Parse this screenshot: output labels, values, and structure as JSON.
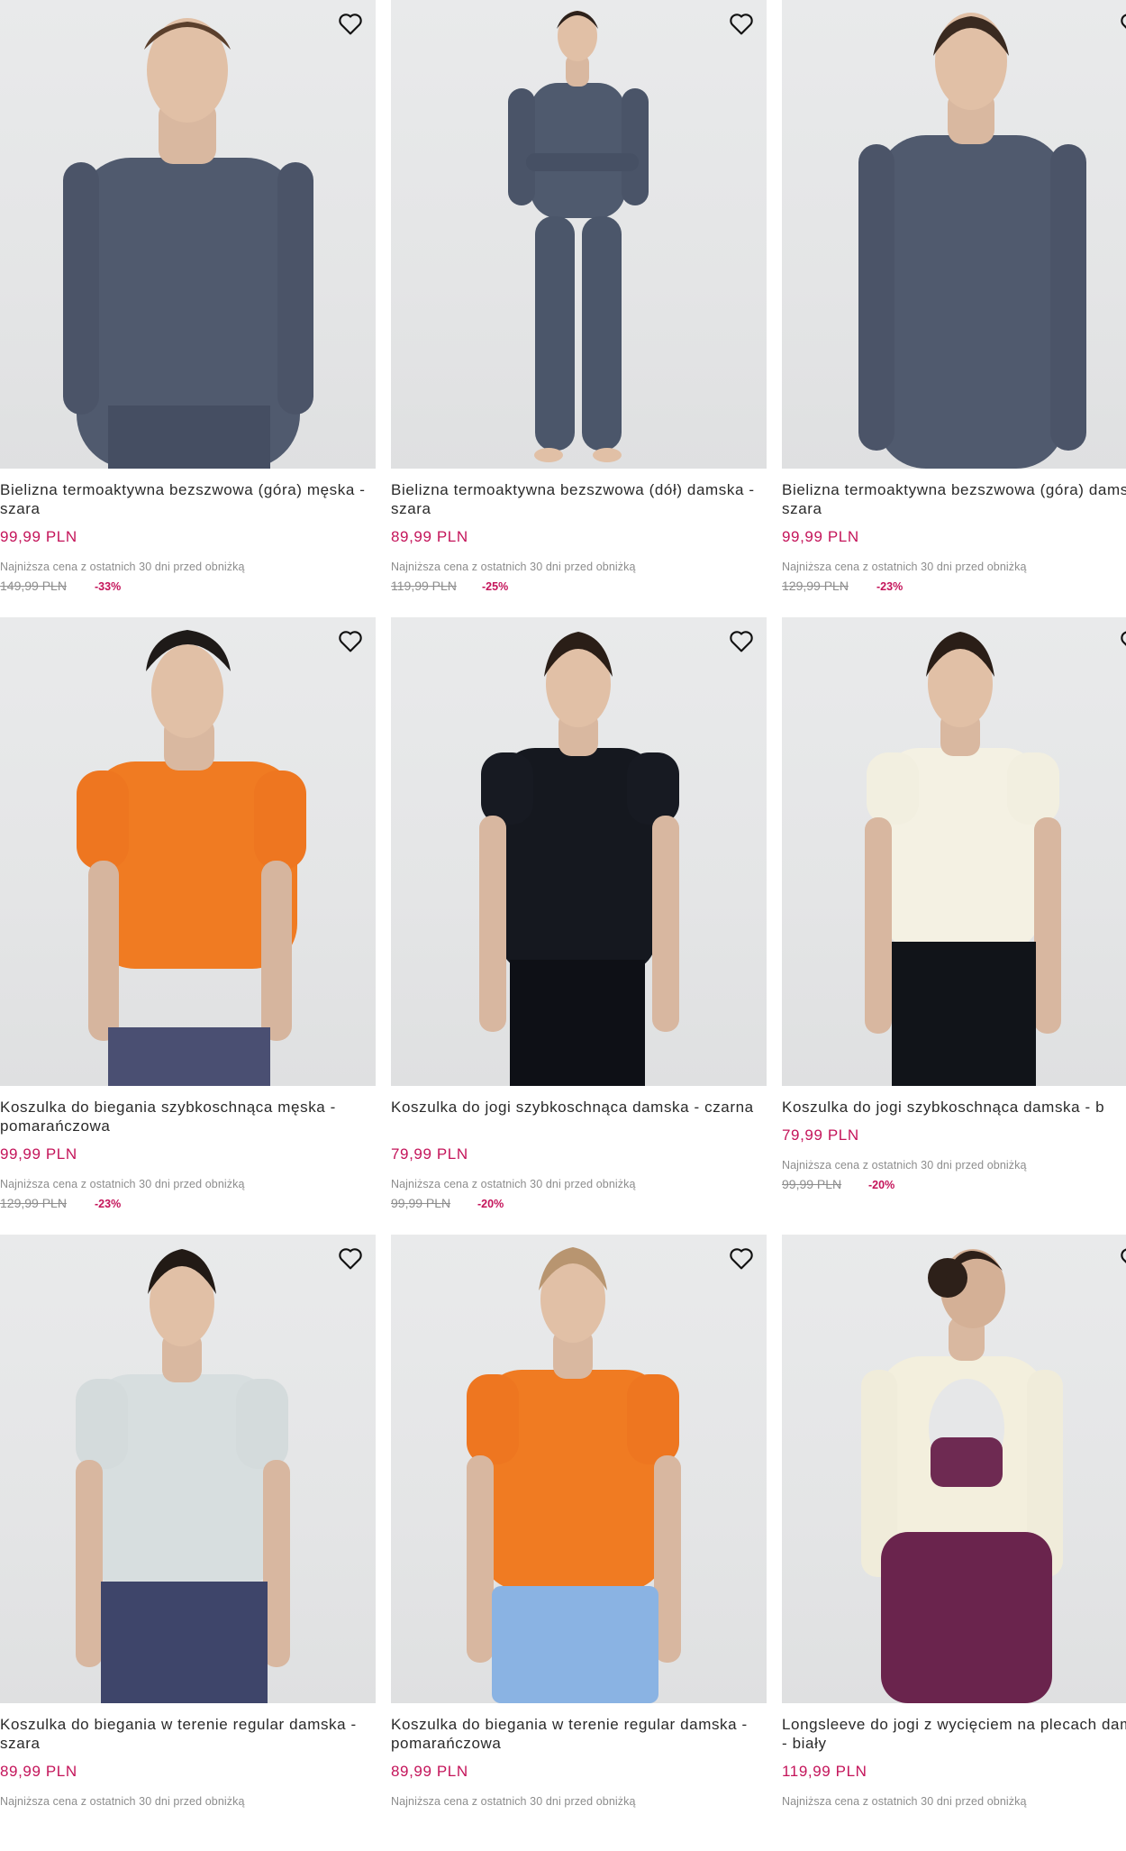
{
  "colors": {
    "accent": "#c4145a",
    "muted": "#8d8d8d",
    "text": "#2a2a2a",
    "image_bg": "#e6e7e8"
  },
  "products": [
    {
      "title": "Bielizna termoaktywna bezszwowa (góra) męska - szara",
      "price": "99,99 PLN",
      "lowest_label": "Najniższa cena z ostatnich 30 dni przed obniżką",
      "old_price": "149,99 PLN",
      "discount": "-33%",
      "image": "man-grey-thermal-top",
      "wishlist_icon": "heart-outline-icon"
    },
    {
      "title": "Bielizna termoaktywna bezszwowa (dół) damska - szara",
      "price": "89,99 PLN",
      "lowest_label": "Najniższa cena z ostatnich 30 dni przed obniżką",
      "old_price": "119,99 PLN",
      "discount": "-25%",
      "image": "woman-grey-thermal-set",
      "wishlist_icon": "heart-outline-icon"
    },
    {
      "title": "Bielizna termoaktywna bezszwowa (góra) damska - szara",
      "price": "99,99 PLN",
      "lowest_label": "Najniższa cena z ostatnich 30 dni przed obniżką",
      "old_price": "129,99 PLN",
      "discount": "-23%",
      "image": "woman-grey-thermal-top",
      "wishlist_icon": "heart-outline-icon"
    },
    {
      "title": "Koszulka do biegania szybkoschnąca męska - pomarańczowa",
      "price": "99,99 PLN",
      "lowest_label": "Najniższa cena z ostatnich 30 dni przed obniżką",
      "old_price": "129,99 PLN",
      "discount": "-23%",
      "image": "man-orange-tshirt",
      "wishlist_icon": "heart-outline-icon"
    },
    {
      "title": "Koszulka do jogi szybkoschnąca damska - czarna",
      "price": "79,99 PLN",
      "lowest_label": "Najniższa cena z ostatnich 30 dni przed obniżką",
      "old_price": "99,99 PLN",
      "discount": "-20%",
      "image": "woman-black-tshirt",
      "wishlist_icon": "heart-outline-icon"
    },
    {
      "title": "Koszulka do jogi szybkoschnąca damska - b",
      "price": "79,99 PLN",
      "lowest_label": "Najniższa cena z ostatnich 30 dni przed obniżką",
      "old_price": "99,99 PLN",
      "discount": "-20%",
      "image": "woman-cream-tshirt",
      "wishlist_icon": "heart-outline-icon"
    },
    {
      "title": "Koszulka do biegania w terenie regular damska - szara",
      "price": "89,99 PLN",
      "lowest_label": "Najniższa cena z ostatnich 30 dni przed obniżką",
      "old_price": "",
      "discount": "",
      "image": "woman-light-grey-tshirt",
      "wishlist_icon": "heart-outline-icon"
    },
    {
      "title": "Koszulka do biegania w terenie regular damska - pomarańczowa",
      "price": "89,99 PLN",
      "lowest_label": "Najniższa cena z ostatnich 30 dni przed obniżką",
      "old_price": "",
      "discount": "",
      "image": "woman-orange-tshirt",
      "wishlist_icon": "heart-outline-icon"
    },
    {
      "title": "Longsleeve do jogi z wycięciem na plecach damski - biały",
      "price": "119,99 PLN",
      "lowest_label": "Najniższa cena z ostatnich 30 dni przed obniżką",
      "old_price": "",
      "discount": "",
      "image": "woman-white-longsleeve-back",
      "wishlist_icon": "heart-outline-icon"
    }
  ]
}
